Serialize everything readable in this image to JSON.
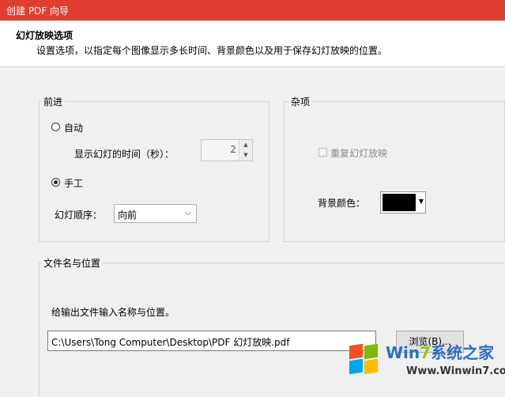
{
  "window": {
    "title": "创建 PDF 向导"
  },
  "header": {
    "title": "幻灯放映选项",
    "description": "设置选项，以指定每个图像显示多长时间、背景颜色以及用于保存幻灯放映的位置。"
  },
  "advance": {
    "group_label": "前进",
    "auto_label": "自动",
    "duration_label": "显示幻灯的时间（秒）：",
    "duration_value": "2",
    "manual_label": "手工",
    "order_label": "幻灯顺序：",
    "order_value": "向前",
    "selected_mode": "manual"
  },
  "misc": {
    "group_label": "杂项",
    "repeat_label": "重复幻灯放映",
    "repeat_checked": false,
    "bg_color_label": "背景颜色：",
    "bg_color": "#000000"
  },
  "file": {
    "group_label": "文件名与位置",
    "instruction": "给输出文件输入名称与位置。",
    "path_value": "C:\\Users\\Tong Computer\\Desktop\\PDF 幻灯放映.pdf",
    "browse_label": "浏览(B)..."
  },
  "watermark": {
    "brand_win": "Win",
    "brand_seven": "7",
    "brand_rest": "系统之家",
    "url": "Www.Winwin7.com"
  },
  "colors": {
    "titlebar": "#e03f2f",
    "background": "#f0f0f0"
  }
}
